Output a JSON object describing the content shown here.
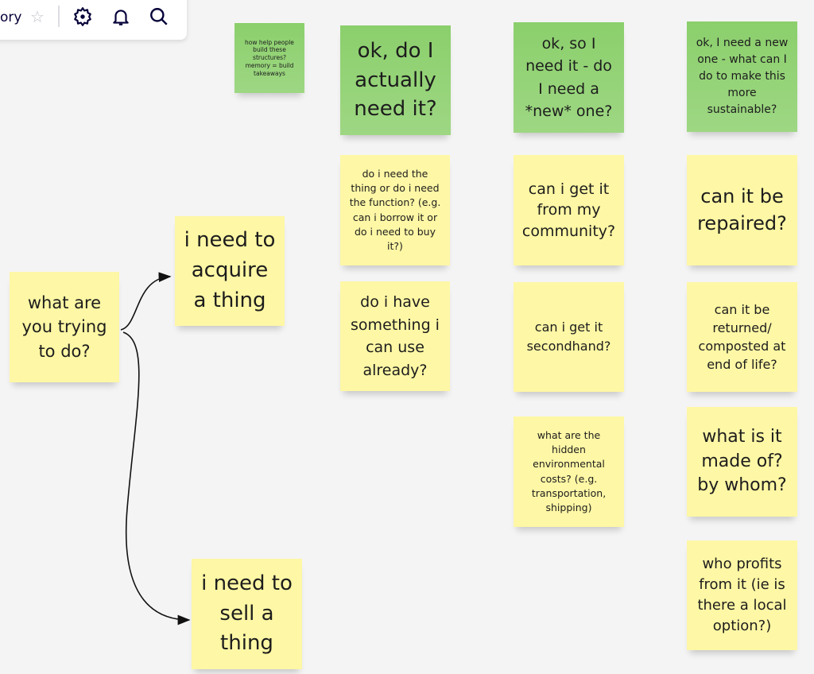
{
  "toolbar": {
    "title_fragment": "ory",
    "icons": [
      "star-icon",
      "gear-icon",
      "bell-icon",
      "search-icon"
    ]
  },
  "colors": {
    "yellow_note": "#fef7a5",
    "green_note": "#8fd16f",
    "canvas": "#f4f4f4"
  },
  "notes": {
    "memo": "how help people build these structures? memory = build takeaways",
    "green_1": "ok, do I actually need it?",
    "green_2": "ok, so I need it - do I need a *new* one?",
    "green_3": "ok, I need a new one - what can I do to make this more sustainable?",
    "start": "what are you trying to do?",
    "acquire": "i need to acquire a thing",
    "sell": "i need to sell a thing",
    "c1_1": "do i need the thing or do i need the function? (e.g. can i borrow it or do i need to buy it?)",
    "c1_2": "do i have something i can use already?",
    "c2_1": "can i get it from my community?",
    "c2_2": "can i get it secondhand?",
    "c2_3": "what are the hidden environmental costs? (e.g. transportation, shipping)",
    "c3_1": "can it be repaired?",
    "c3_2": "can it be returned/ composted at end of life?",
    "c3_3": "what is it made of? by whom?",
    "c3_4": "who profits from it (ie is there a local option?)"
  }
}
